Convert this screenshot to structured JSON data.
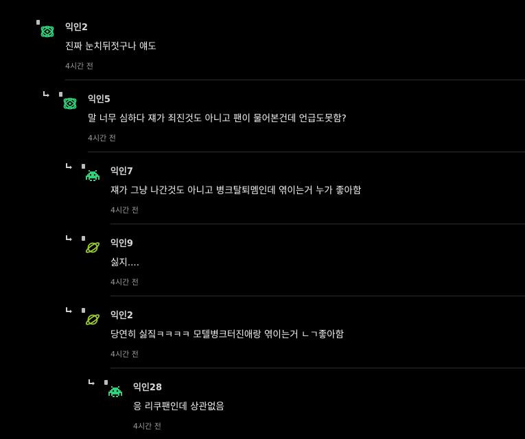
{
  "comments": [
    {
      "name": "익인2",
      "text": "진짜 눈치뒤젓구나 얘도",
      "time": "4시간 전",
      "avatar_icon": "atom-icon",
      "avatar_color": "#2fd17a",
      "is_reply": false
    },
    {
      "name": "익인5",
      "text": "말 너무 심하다 쟤가 죄진것도 아니고 팬이 물어본건데 언급도못함?",
      "time": "4시간 전",
      "avatar_icon": "atom-icon",
      "avatar_color": "#2fd17a",
      "is_reply": true
    },
    {
      "name": "익인7",
      "text": "쟤가 그냥 나간것도 아니고 병크탈퇴멤인데 엮이는거 누가 좋아함",
      "time": "4시간 전",
      "avatar_icon": "space-invader-icon",
      "avatar_color": "#2fd17a",
      "is_reply": true
    },
    {
      "name": "익인9",
      "text": "싫지....",
      "time": "4시간 전",
      "avatar_icon": "planet-icon",
      "avatar_color": "#9acd32",
      "is_reply": true
    },
    {
      "name": "익인2",
      "text": "당연히 싫짘ㅋㅋㅋㅋ 모텔병크터진애랑 엮이는거 ㄴㄱ좋아함",
      "time": "4시간 전",
      "avatar_icon": "planet-icon",
      "avatar_color": "#9acd32",
      "is_reply": true
    },
    {
      "name": "익인28",
      "text": "응 리쿠팬인데 상관없음",
      "time": "4시간 전",
      "avatar_icon": "space-invader-icon",
      "avatar_color": "#2fd17a",
      "is_reply": true
    }
  ]
}
